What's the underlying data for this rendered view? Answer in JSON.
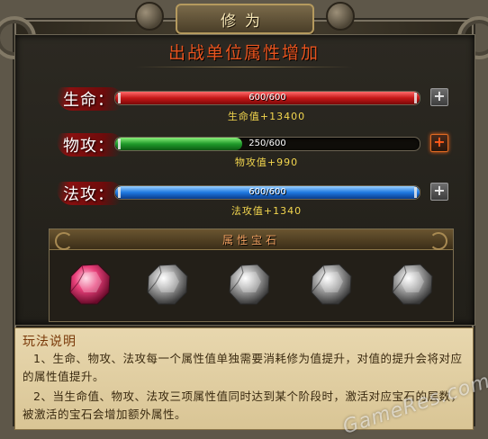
{
  "window": {
    "title": "修为"
  },
  "section": {
    "title": "出战单位属性增加"
  },
  "stats": [
    {
      "label": "生命",
      "colon": "：",
      "value_text": "600/600",
      "current": 600,
      "max": 600,
      "bonus": "生命值+13400",
      "color": "red",
      "upgrade_highlighted": false
    },
    {
      "label": "物攻",
      "colon": "：",
      "value_text": "250/600",
      "current": 250,
      "max": 600,
      "bonus": "物攻值+990",
      "color": "green",
      "upgrade_highlighted": true
    },
    {
      "label": "法攻",
      "colon": "：",
      "value_text": "600/600",
      "current": 600,
      "max": 600,
      "bonus": "法攻值+1340",
      "color": "blue",
      "upgrade_highlighted": false
    }
  ],
  "upgrade_icon": "+",
  "gems": {
    "title": "属性宝石",
    "items": [
      {
        "name": "gem-1",
        "active": true,
        "color": "#e03a6a"
      },
      {
        "name": "gem-2",
        "active": false,
        "color": "#9a9a9a"
      },
      {
        "name": "gem-3",
        "active": false,
        "color": "#9a9a9a"
      },
      {
        "name": "gem-4",
        "active": false,
        "color": "#9a9a9a"
      },
      {
        "name": "gem-5",
        "active": false,
        "color": "#9a9a9a"
      }
    ]
  },
  "instructions": {
    "title": "玩法说明",
    "p1": "1、生命、物攻、法攻每一个属性值单独需要消耗修为值提升，对值的提升会将对应的属性值提升。",
    "p2": "2、当生命值、物攻、法攻三项属性值同时达到某个阶段时，激活对应宝石的层数，被激活的宝石会增加额外属性。"
  },
  "watermark": "GameRes.com"
}
